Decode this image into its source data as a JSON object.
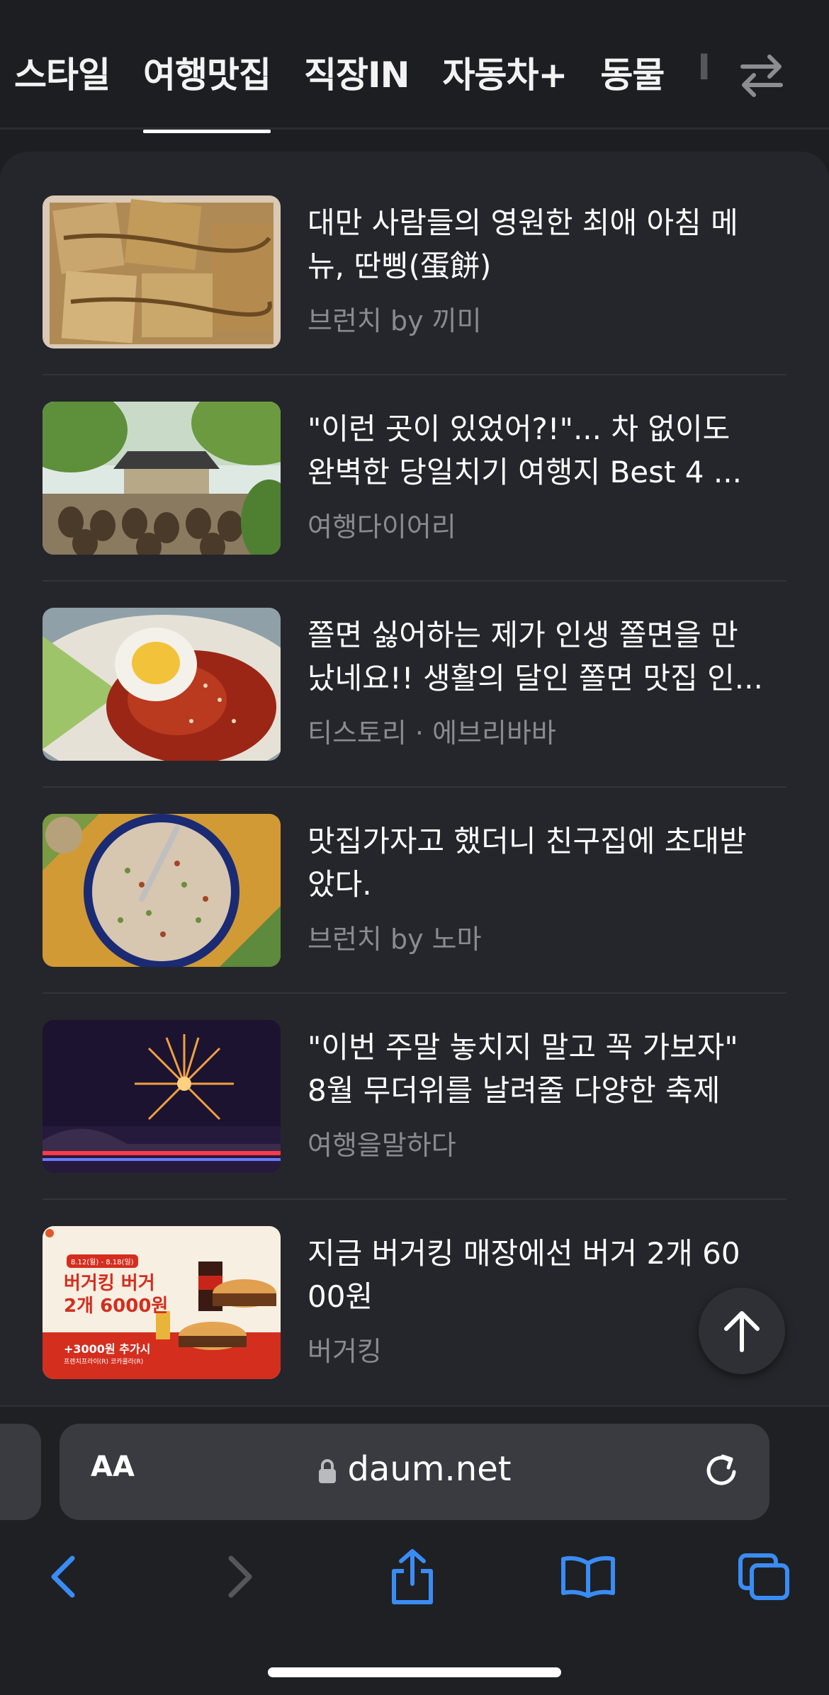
{
  "tabs": [
    {
      "label": "스타일",
      "active": false
    },
    {
      "label": "여행맛집",
      "active": true
    },
    {
      "label": "직장IN",
      "active": false
    },
    {
      "label": "자동차+",
      "active": false
    },
    {
      "label": "동물",
      "active": false
    },
    {
      "label": "I",
      "active": false
    }
  ],
  "articles": [
    {
      "title_line1": "대만 사람들의 영원한 최애 아침 메",
      "title_line2": "뉴, 딴삥(蛋餅)",
      "source": "브런치 by 끼미"
    },
    {
      "title_line1": "\"이런 곳이 있었어?!\"... 차 없이도",
      "title_line2": "완벽한 당일치기 여행지 Best 4 ...",
      "source": "여행다이어리"
    },
    {
      "title_line1": "쫄면 싫어하는 제가 인생 쫄면을 만",
      "title_line2": "났네요!! 생활의 달인 쫄면 맛집 인...",
      "source": "티스토리 · 에브리바바"
    },
    {
      "title_line1": "맛집가자고 했더니 친구집에 초대받",
      "title_line2": "았다.",
      "source": "브런치 by 노마"
    },
    {
      "title_line1": "\"이번 주말 놓치지 말고 꼭 가보자\"",
      "title_line2": "8월 무더위를 날려줄 다양한 축제",
      "source": "여행을말하다"
    },
    {
      "title_line1": "지금 버거킹 매장에선 버거 2개 60",
      "title_line2": "00원",
      "source": "버거킹"
    }
  ],
  "ad": {
    "date": "8.12(월) - 8.18(일)",
    "headline1": "버거킹 버거",
    "headline2": "2개 6000원",
    "extra": "+3000원 추가시",
    "extra2": "프렌치프라이(R) 코카콜라(R)"
  },
  "browser": {
    "aa_label": "AA",
    "url": "daum.net"
  },
  "colors": {
    "background": "#1d1e22",
    "card": "#25262b",
    "accent": "#3a8cf5",
    "muted": "#8a8b90"
  },
  "icons": {
    "swap": "swap-arrows-icon",
    "up": "arrow-up-icon",
    "lock": "lock-icon",
    "reload": "reload-icon",
    "back": "chevron-left-icon",
    "forward": "chevron-right-icon",
    "share": "share-icon",
    "bookmarks": "book-icon",
    "tabs": "tabs-icon"
  }
}
